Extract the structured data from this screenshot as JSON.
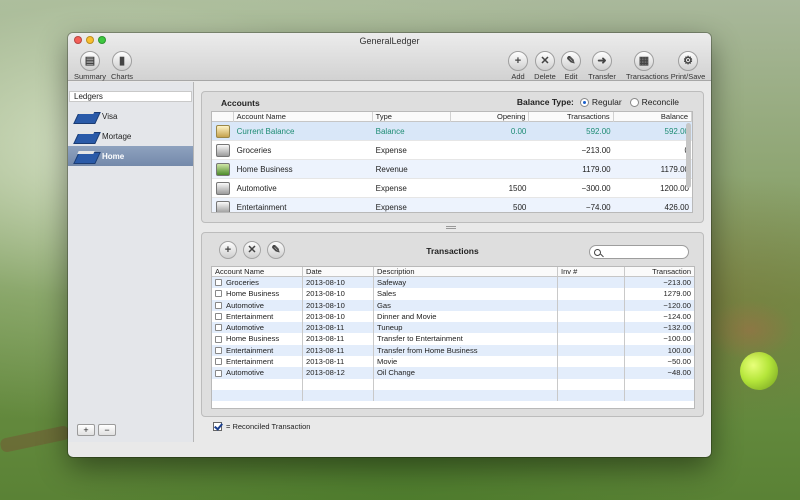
{
  "window": {
    "title": "GeneralLedger"
  },
  "toolbar": {
    "left": [
      {
        "label": "Summary",
        "icon": "summary-icon"
      },
      {
        "label": "Charts",
        "icon": "bar-chart-icon"
      }
    ],
    "right": [
      {
        "label": "Add",
        "icon": "plus-icon"
      },
      {
        "label": "Delete",
        "icon": "x-icon"
      },
      {
        "label": "Edit",
        "icon": "pencil-icon"
      },
      {
        "label": "Transfer",
        "icon": "arrow-right-icon"
      },
      {
        "label": "Transactions",
        "icon": "calculator-icon"
      },
      {
        "label": "Print/Save",
        "icon": "gear-icon"
      }
    ]
  },
  "sidebar": {
    "header": "Ledgers",
    "items": [
      {
        "label": "Visa",
        "selected": false
      },
      {
        "label": "Mortage",
        "selected": false
      },
      {
        "label": "Home",
        "selected": true
      }
    ],
    "add_label": "+",
    "remove_label": "−"
  },
  "accounts": {
    "title": "Accounts",
    "balance_type_label": "Balance Type:",
    "balance_options": [
      "Regular",
      "Reconcile"
    ],
    "balance_selected": "Regular",
    "columns": [
      "Account Name",
      "Type",
      "Opening",
      "Transactions",
      "Balance"
    ],
    "rows": [
      {
        "name": "Current Balance",
        "type": "Balance",
        "opening": "0.00",
        "transactions": "592.00",
        "balance": "592.00",
        "icon": "coins-icon"
      },
      {
        "name": "Groceries",
        "type": "Expense",
        "opening": "",
        "transactions": "−213.00",
        "balance": "0",
        "icon": "register-icon"
      },
      {
        "name": "Home Business",
        "type": "Revenue",
        "opening": "",
        "transactions": "1179.00",
        "balance": "1179.00",
        "icon": "money-register-icon"
      },
      {
        "name": "Automotive",
        "type": "Expense",
        "opening": "1500",
        "transactions": "−300.00",
        "balance": "1200.00",
        "icon": "register-icon"
      },
      {
        "name": "Entertainment",
        "type": "Expense",
        "opening": "500",
        "transactions": "−74.00",
        "balance": "426.00",
        "icon": "register-icon"
      }
    ]
  },
  "transactions": {
    "title": "Transactions",
    "search_placeholder": "",
    "columns": [
      "Account Name",
      "Date",
      "Description",
      "Inv #",
      "Transaction"
    ],
    "rows": [
      {
        "account": "Groceries",
        "date": "2013-08-10",
        "description": "Safeway",
        "inv": "",
        "amount": "−213.00"
      },
      {
        "account": "Home Business",
        "date": "2013-08-10",
        "description": "Sales",
        "inv": "",
        "amount": "1279.00"
      },
      {
        "account": "Automotive",
        "date": "2013-08-10",
        "description": "Gas",
        "inv": "",
        "amount": "−120.00"
      },
      {
        "account": "Entertainment",
        "date": "2013-08-10",
        "description": "Dinner and Movie",
        "inv": "",
        "amount": "−124.00"
      },
      {
        "account": "Automotive",
        "date": "2013-08-11",
        "description": "Tuneup",
        "inv": "",
        "amount": "−132.00"
      },
      {
        "account": "Home Business",
        "date": "2013-08-11",
        "description": "Transfer to Entertainment",
        "inv": "",
        "amount": "−100.00"
      },
      {
        "account": "Entertainment",
        "date": "2013-08-11",
        "description": "Transfer from Home Business",
        "inv": "",
        "amount": "100.00"
      },
      {
        "account": "Entertainment",
        "date": "2013-08-11",
        "description": "Movie",
        "inv": "",
        "amount": "−50.00"
      },
      {
        "account": "Automotive",
        "date": "2013-08-12",
        "description": "Oil Change",
        "inv": "",
        "amount": "−48.00"
      }
    ],
    "empty_rows": 2
  },
  "legend": {
    "label": "= Reconciled Transaction"
  }
}
